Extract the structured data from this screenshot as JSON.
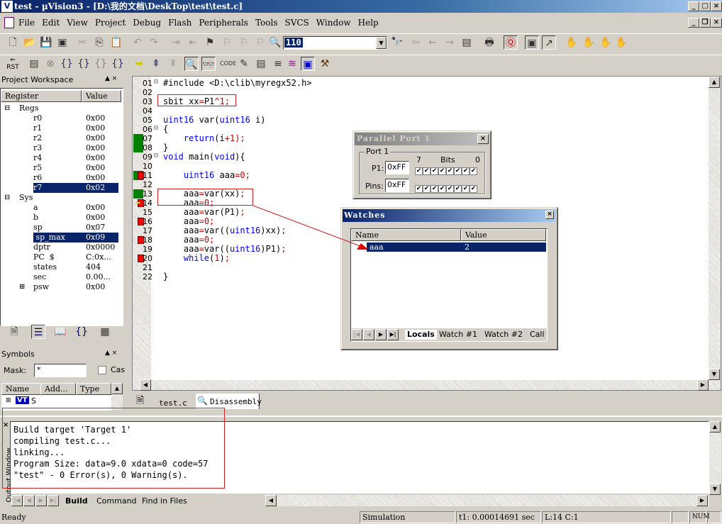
{
  "window": {
    "title": "test   - µVision3 - [D:\\我的文档\\DeskTop\\test\\test.c]",
    "app_icon": "uvision-icon"
  },
  "menu": [
    "File",
    "Edit",
    "View",
    "Project",
    "Debug",
    "Flash",
    "Peripherals",
    "Tools",
    "SVCS",
    "Window",
    "Help"
  ],
  "toolbar": {
    "find_value": "110"
  },
  "workspace": {
    "title": "Project Workspace",
    "columns": [
      "Register",
      "Value"
    ],
    "tree": [
      {
        "name": "Regs",
        "value": "",
        "level": 0,
        "expander": "minus"
      },
      {
        "name": "r0",
        "value": "0x00",
        "level": 1
      },
      {
        "name": "r1",
        "value": "0x00",
        "level": 1
      },
      {
        "name": "r2",
        "value": "0x00",
        "level": 1
      },
      {
        "name": "r3",
        "value": "0x00",
        "level": 1
      },
      {
        "name": "r4",
        "value": "0x00",
        "level": 1
      },
      {
        "name": "r5",
        "value": "0x00",
        "level": 1
      },
      {
        "name": "r6",
        "value": "0x00",
        "level": 1
      },
      {
        "name": "r7",
        "value": "0x02",
        "level": 1,
        "selected": true
      },
      {
        "name": "Sys",
        "value": "",
        "level": 0,
        "expander": "minus"
      },
      {
        "name": "a",
        "value": "0x00",
        "level": 1
      },
      {
        "name": "b",
        "value": "0x00",
        "level": 1
      },
      {
        "name": "sp",
        "value": "0x07",
        "level": 1
      },
      {
        "name": " sp_max",
        "value": "0x09",
        "level": 1,
        "selected": true
      },
      {
        "name": "dptr",
        "value": "0x0000",
        "level": 1
      },
      {
        "name": "PC  $",
        "value": "C:0x...",
        "level": 1
      },
      {
        "name": "states",
        "value": "404",
        "level": 1
      },
      {
        "name": "sec",
        "value": "0.00...",
        "level": 1
      },
      {
        "name": "psw",
        "value": "0x00",
        "level": 1,
        "expander": "plus"
      }
    ]
  },
  "symbols": {
    "title": "Symbols",
    "mask_label": "Mask:",
    "mask_value": "*",
    "case_label": "Case",
    "columns": [
      "Name",
      "Add...",
      "Type"
    ],
    "row": {
      "badge": "VT",
      "name": "S"
    }
  },
  "editor": {
    "lines": [
      {
        "n": "01",
        "fold": "box",
        "gutter": "",
        "tokens": [
          [
            "#include <D:\\clib\\myregx52.h>",
            "pl"
          ]
        ]
      },
      {
        "n": "02",
        "gutter": "",
        "tokens": []
      },
      {
        "n": "03",
        "gutter": "",
        "tokens": [
          [
            "sbit xx",
            "pl"
          ],
          [
            "=",
            "op"
          ],
          [
            "P1",
            "pl"
          ],
          [
            "^",
            "op"
          ],
          [
            "1",
            "num"
          ],
          [
            ";",
            "op"
          ]
        ]
      },
      {
        "n": "04",
        "gutter": "",
        "tokens": []
      },
      {
        "n": "05",
        "gutter": "",
        "tokens": [
          [
            "uint16",
            "kw"
          ],
          [
            " var(",
            "pl"
          ],
          [
            "uint16",
            "kw"
          ],
          [
            " i)",
            "pl"
          ]
        ]
      },
      {
        "n": "06",
        "fold": "box",
        "gutter": "",
        "tokens": [
          [
            "{",
            "pl"
          ]
        ]
      },
      {
        "n": "07",
        "gutter": "green",
        "tokens": [
          [
            "    ",
            "pl"
          ],
          [
            "return",
            "kw"
          ],
          [
            "(i",
            "pl"
          ],
          [
            "+",
            "op"
          ],
          [
            "1",
            "num"
          ],
          [
            ");",
            "op"
          ]
        ]
      },
      {
        "n": "08",
        "gutter": "green",
        "tokens": [
          [
            "}",
            "pl"
          ]
        ]
      },
      {
        "n": "09",
        "fold": "box",
        "gutter": "",
        "tokens": [
          [
            "void",
            "kw"
          ],
          [
            " main(",
            "pl"
          ],
          [
            "void",
            "kw"
          ],
          [
            "){",
            "pl"
          ]
        ]
      },
      {
        "n": "10",
        "gutter": "",
        "tokens": []
      },
      {
        "n": "11",
        "gutter": "green-bp",
        "tokens": [
          [
            "    ",
            "pl"
          ],
          [
            "uint16",
            "kw"
          ],
          [
            " aaa",
            "pl"
          ],
          [
            "=",
            "op"
          ],
          [
            "0",
            "num"
          ],
          [
            ";",
            "op"
          ]
        ]
      },
      {
        "n": "12",
        "gutter": "",
        "tokens": []
      },
      {
        "n": "13",
        "gutter": "green",
        "tokens": [
          [
            "    aaa",
            "pl"
          ],
          [
            "=",
            "op"
          ],
          [
            "var(xx)",
            "pl"
          ],
          [
            ";",
            "op"
          ]
        ]
      },
      {
        "n": "14",
        "gutter": "bp-arrow",
        "tokens": [
          [
            "    aaa",
            "pl"
          ],
          [
            "=",
            "op"
          ],
          [
            "0",
            "num"
          ],
          [
            ";",
            "op"
          ]
        ]
      },
      {
        "n": "15",
        "gutter": "",
        "tokens": [
          [
            "    aaa",
            "pl"
          ],
          [
            "=",
            "op"
          ],
          [
            "var(P1)",
            "pl"
          ],
          [
            ";",
            "op"
          ]
        ]
      },
      {
        "n": "16",
        "gutter": "bp",
        "tokens": [
          [
            "    aaa",
            "pl"
          ],
          [
            "=",
            "op"
          ],
          [
            "0",
            "num"
          ],
          [
            ";",
            "op"
          ]
        ]
      },
      {
        "n": "17",
        "gutter": "",
        "tokens": [
          [
            "    aaa",
            "pl"
          ],
          [
            "=",
            "op"
          ],
          [
            "var((",
            "pl"
          ],
          [
            "uint16",
            "kw"
          ],
          [
            ")xx)",
            "pl"
          ],
          [
            ";",
            "op"
          ]
        ]
      },
      {
        "n": "18",
        "gutter": "bp",
        "tokens": [
          [
            "    aaa",
            "pl"
          ],
          [
            "=",
            "op"
          ],
          [
            "0",
            "num"
          ],
          [
            ";",
            "op"
          ]
        ]
      },
      {
        "n": "19",
        "gutter": "",
        "tokens": [
          [
            "    aaa",
            "pl"
          ],
          [
            "=",
            "op"
          ],
          [
            "var((",
            "pl"
          ],
          [
            "uint16",
            "kw"
          ],
          [
            ")P1)",
            "pl"
          ],
          [
            ";",
            "op"
          ]
        ]
      },
      {
        "n": "20",
        "gutter": "bp",
        "tokens": [
          [
            "    ",
            "pl"
          ],
          [
            "while",
            "kw"
          ],
          [
            "(",
            "pl"
          ],
          [
            "1",
            "num"
          ],
          [
            ")",
            "pl"
          ],
          [
            ";",
            "op"
          ]
        ]
      },
      {
        "n": "21",
        "gutter": "",
        "tokens": []
      },
      {
        "n": "22",
        "gutter": "",
        "tokens": [
          [
            "}",
            "pl"
          ]
        ]
      }
    ],
    "tabs": [
      {
        "label": "test.c",
        "icon": "document-icon"
      },
      {
        "label": "Disassembly",
        "icon": "disassembly-icon",
        "active": true
      }
    ]
  },
  "parallel_port": {
    "title": "Parallel Port 1",
    "group": "Port 1",
    "bits_label": "Bits",
    "bit_hi": "7",
    "bit_lo": "0",
    "p1_label": "P1:",
    "p1_value": "0xFF",
    "pins_label": "Pins:",
    "pins_value": "0xFF",
    "p1_bits": [
      1,
      1,
      1,
      1,
      1,
      1,
      1,
      1
    ],
    "pins_bits": [
      1,
      1,
      1,
      1,
      1,
      1,
      1,
      1
    ]
  },
  "watches": {
    "title": "Watches",
    "columns": [
      "Name",
      "Value"
    ],
    "rows": [
      {
        "name": "aaa",
        "value": "2"
      }
    ],
    "tabs": [
      "Locals",
      "Watch #1",
      "Watch #2",
      "Call S"
    ]
  },
  "output": {
    "side_label": "Output Window",
    "lines": [
      "Build target 'Target 1'",
      "compiling test.c...",
      "linking...",
      "Program Size: data=9.0 xdata=0 code=57",
      "\"test\" - 0 Error(s), 0 Warning(s)."
    ],
    "tabs": [
      "Build",
      "Command",
      "Find in Files"
    ]
  },
  "status": {
    "ready": "Ready",
    "mode": "Simulation",
    "time": "t1: 0.00014691 sec",
    "position": "L:14 C:1",
    "num": "NUM"
  },
  "colors": {
    "selection": "#0a246a",
    "annotation": "#d02020",
    "exec_green": "#008000",
    "breakpoint": "#ff0000"
  }
}
